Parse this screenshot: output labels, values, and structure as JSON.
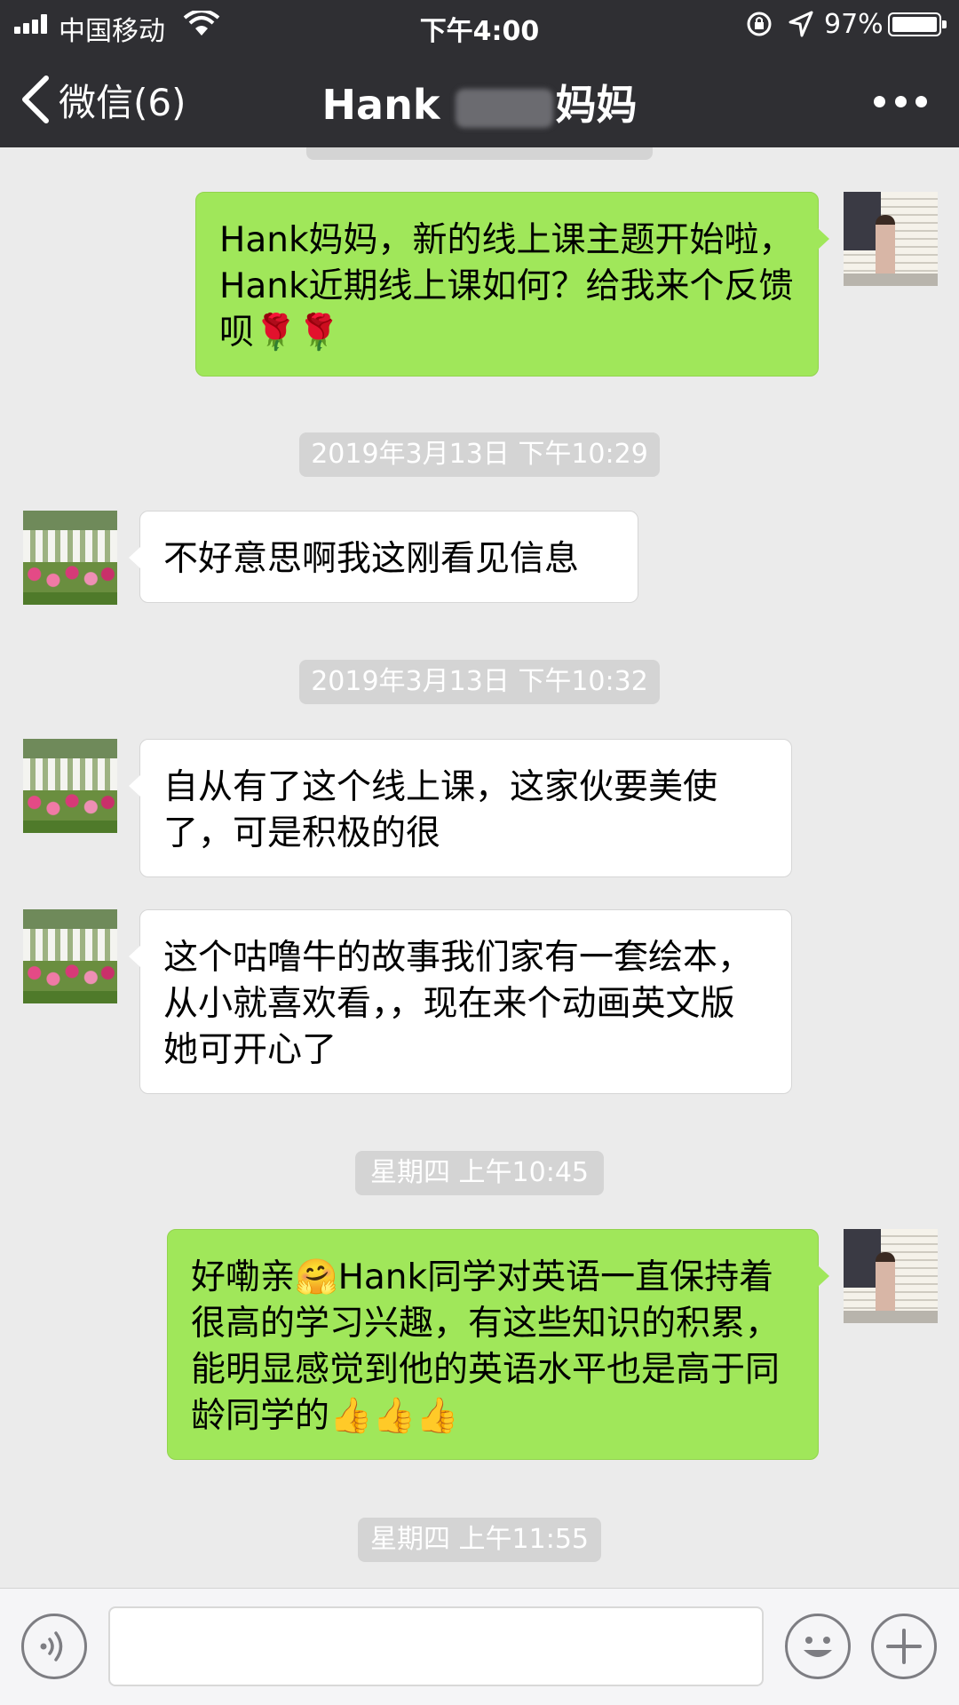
{
  "status_bar": {
    "carrier": "中国移动",
    "time": "下午4:00",
    "battery": "97%"
  },
  "nav": {
    "back_label": "微信(6)",
    "title_prefix": "Hank ",
    "title_suffix": "妈妈"
  },
  "messages": [
    {
      "from": "me",
      "text": "Hank妈妈，新的线上课主题开始啦，Hank近期线上课如何？给我来个反馈呗"
    },
    {
      "timestamp": "2019年3月13日 下午10:29"
    },
    {
      "from": "her",
      "text": "不好意思啊我这刚看见信息"
    },
    {
      "timestamp": "2019年3月13日 下午10:32"
    },
    {
      "from": "her",
      "text": "自从有了这个线上课，这家伙要美使了，可是积极的很"
    },
    {
      "from": "her",
      "text": "这个咕噜牛的故事我们家有一套绘本，从小就喜欢看，，现在来个动画英文版她可开心了"
    },
    {
      "timestamp": "星期四 上午10:45"
    },
    {
      "from": "me",
      "text_a": "好嘞亲",
      "text_b": "Hank同学对英语一直保持着很高的学习兴趣，有这些知识的积累，能明显感觉到他的英语水平也是高于同龄同学的"
    },
    {
      "timestamp": "星期四 上午11:55"
    }
  ],
  "emoji": {
    "rose": "🌹",
    "hug": "🤗",
    "thumbs_up": "👍"
  },
  "colors": {
    "nav_bg": "#2f2f33",
    "chat_bg": "#ebebeb",
    "my_bubble": "#a0e75a",
    "their_bubble": "#ffffff",
    "timestamp_bg": "#d4d4d4"
  }
}
